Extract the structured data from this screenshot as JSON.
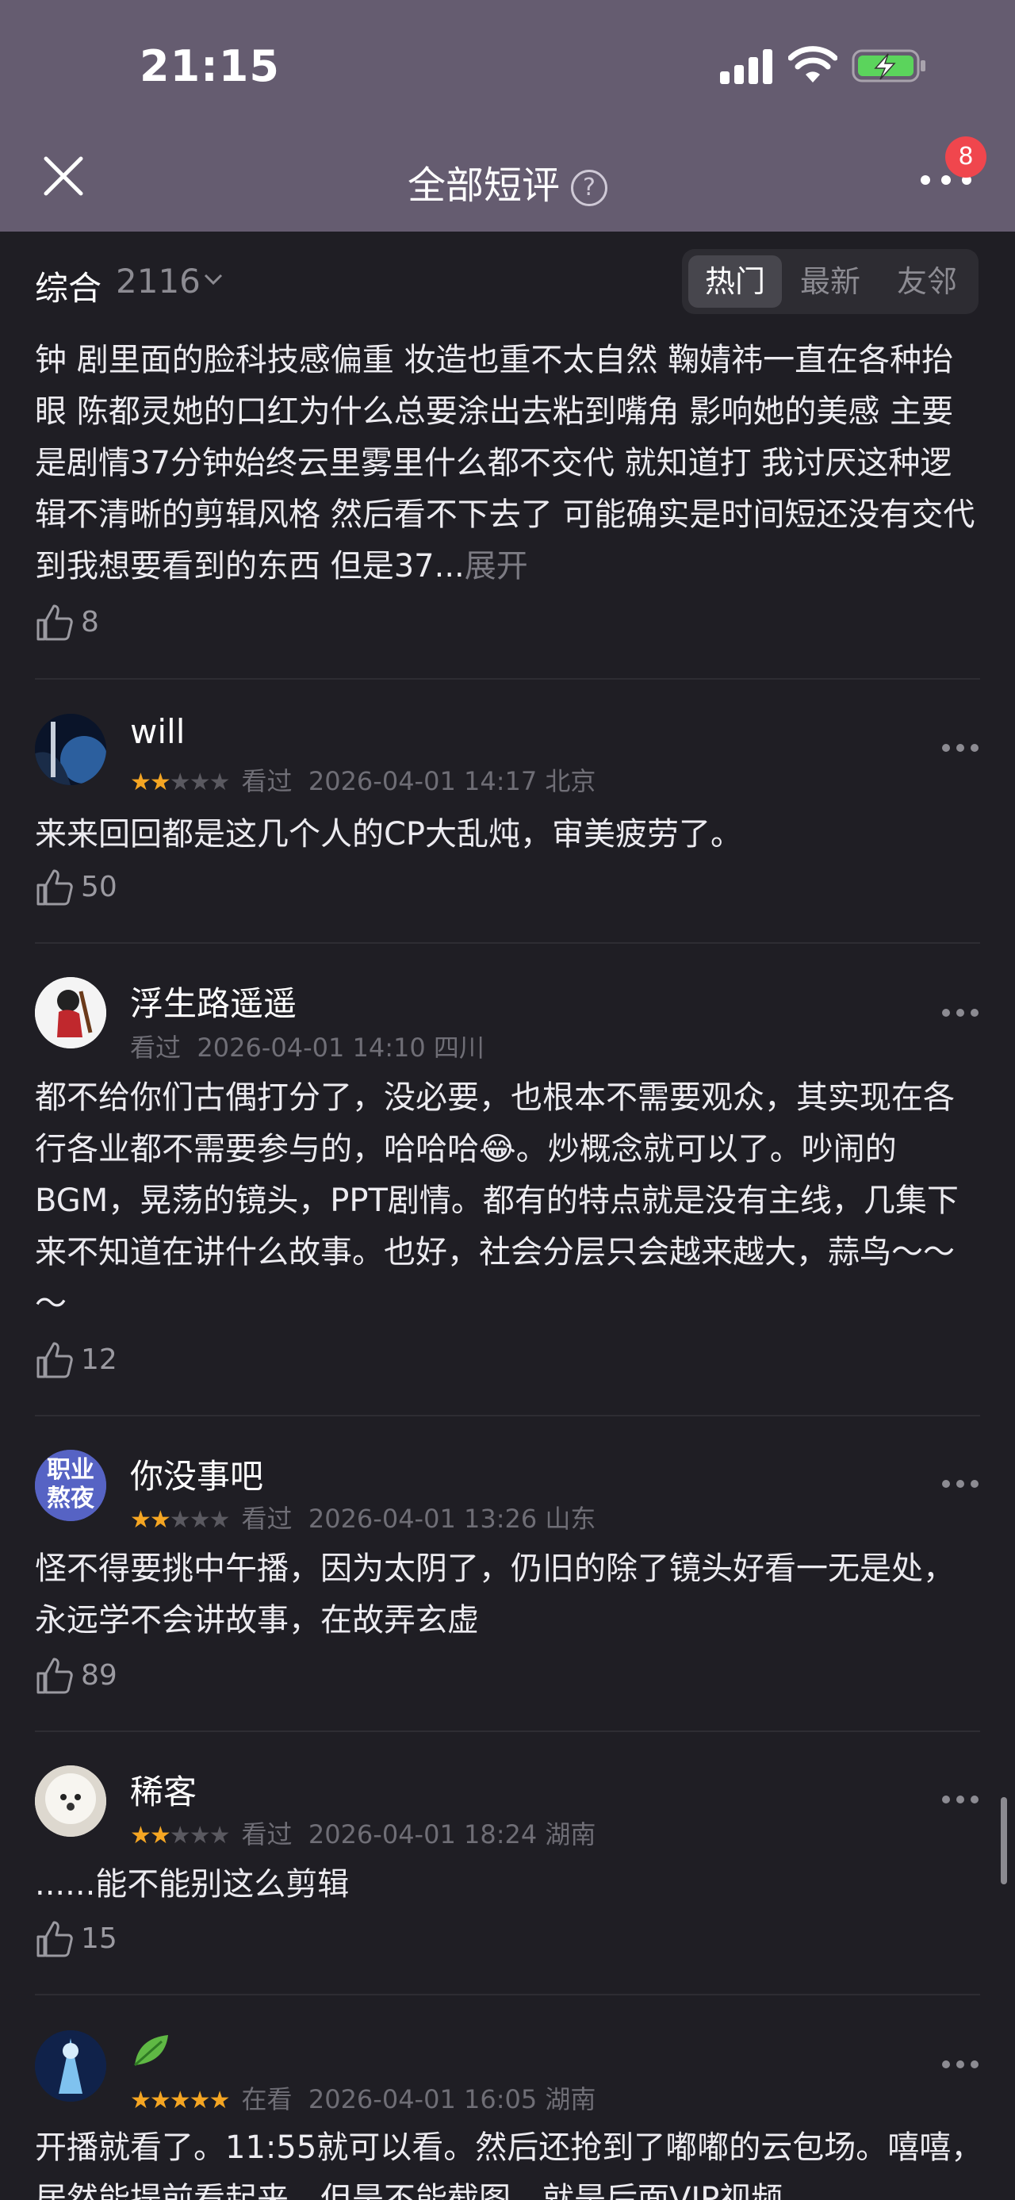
{
  "status": {
    "time": "21:15"
  },
  "header": {
    "title": "全部短评",
    "help_glyph": "?",
    "badge": "8"
  },
  "sort": {
    "label": "综合",
    "count": "2116",
    "tabs": [
      "热门",
      "最新",
      "友邻"
    ],
    "active_tab": 0
  },
  "reviews": [
    {
      "text": "钟 剧里面的脸科技感偏重 妆造也重不太自然 鞠婧祎一直在各种抬眼 陈都灵她的口红为什么总要涂出去粘到嘴角 影响她的美感 主要是剧情37分钟始终云里雾里什么都不交代 就知道打 我讨厌这种逻辑不清晰的剪辑风格 然后看不下去了 可能确实是时间短还没有交代到我想要看到的东西 但是37...",
      "expand": "展开",
      "likes": "8"
    },
    {
      "user": "will",
      "rating": 2,
      "status": "看过",
      "time": "2026-04-01 14:17",
      "location": "北京",
      "text": "来来回回都是这几个人的CP大乱炖，审美疲劳了。",
      "likes": "50"
    },
    {
      "user": "浮生路遥遥",
      "rating": 0,
      "status": "看过",
      "time": "2026-04-01 14:10",
      "location": "四川",
      "text": "都不给你们古偶打分了，没必要，也根本不需要观众，其实现在各行各业都不需要参与的，哈哈哈😂。炒概念就可以了。吵闹的BGM，晃荡的镜头，PPT剧情。都有的特点就是没有主线，几集下来不知道在讲什么故事。也好，社会分层只会越来越大，蒜鸟～～～",
      "likes": "12"
    },
    {
      "user": "你没事吧",
      "rating": 2,
      "status": "看过",
      "time": "2026-04-01 13:26",
      "location": "山东",
      "avatar_text": "职业熬夜",
      "text": "怪不得要挑中午播，因为太阴了，仍旧的除了镜头好看一无是处，永远学不会讲故事，在故弄玄虚",
      "likes": "89"
    },
    {
      "user": "稀客",
      "rating": 2,
      "status": "看过",
      "time": "2026-04-01 18:24",
      "location": "湖南",
      "text": "......能不能别这么剪辑",
      "likes": "15"
    },
    {
      "user": "",
      "rating": 5,
      "status": "在看",
      "time": "2026-04-01 16:05",
      "location": "湖南",
      "text": "开播就看了。11:55就可以看。然后还抢到了嘟嘟的云包场。嘻嘻，居然能提前看起来，但是不能截图，就是后面VIP视频"
    }
  ]
}
